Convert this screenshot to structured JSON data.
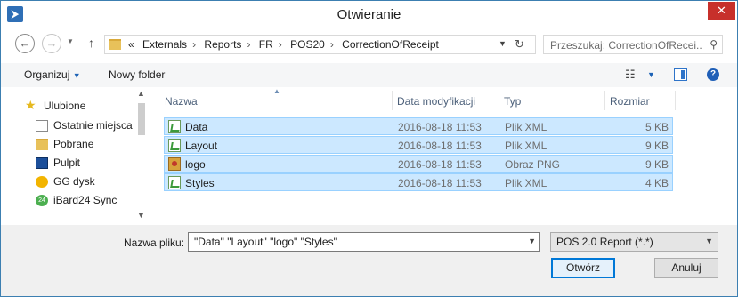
{
  "window": {
    "title": "Otwieranie"
  },
  "address": {
    "crumbs": [
      "«",
      "Externals",
      "Reports",
      "FR",
      "POS20",
      "CorrectionOfReceipt"
    ]
  },
  "search": {
    "placeholder": "Przeszukaj: CorrectionOfRecei..."
  },
  "toolbar": {
    "organize_label": "Organizuj",
    "new_folder_label": "Nowy folder"
  },
  "nav": {
    "items": [
      {
        "label": "Ulubione",
        "icon": "star-icon"
      },
      {
        "label": "Ostatnie miejsca",
        "icon": "recent-places-icon"
      },
      {
        "label": "Pobrane",
        "icon": "downloads-icon"
      },
      {
        "label": "Pulpit",
        "icon": "desktop-icon"
      },
      {
        "label": "GG dysk",
        "icon": "gg-drive-icon"
      },
      {
        "label": "iBard24 Sync",
        "icon": "ibard-sync-icon"
      }
    ]
  },
  "columns": {
    "name": "Nazwa",
    "date": "Data modyfikacji",
    "type": "Typ",
    "size": "Rozmiar"
  },
  "files": [
    {
      "name": "Data",
      "date": "2016-08-18 11:53",
      "type": "Plik XML",
      "size": "5 KB",
      "icon": "xml-file-icon"
    },
    {
      "name": "Layout",
      "date": "2016-08-18 11:53",
      "type": "Plik XML",
      "size": "9 KB",
      "icon": "xml-file-icon"
    },
    {
      "name": "logo",
      "date": "2016-08-18 11:53",
      "type": "Obraz PNG",
      "size": "9 KB",
      "icon": "png-file-icon"
    },
    {
      "name": "Styles",
      "date": "2016-08-18 11:53",
      "type": "Plik XML",
      "size": "4 KB",
      "icon": "xml-file-icon"
    }
  ],
  "bottom": {
    "filename_label": "Nazwa pliku:",
    "filename_value": "\"Data\" \"Layout\" \"logo\" \"Styles\"",
    "filter_value": "POS 2.0 Report (*.*)",
    "open_label": "Otwórz",
    "cancel_label": "Anuluj"
  }
}
